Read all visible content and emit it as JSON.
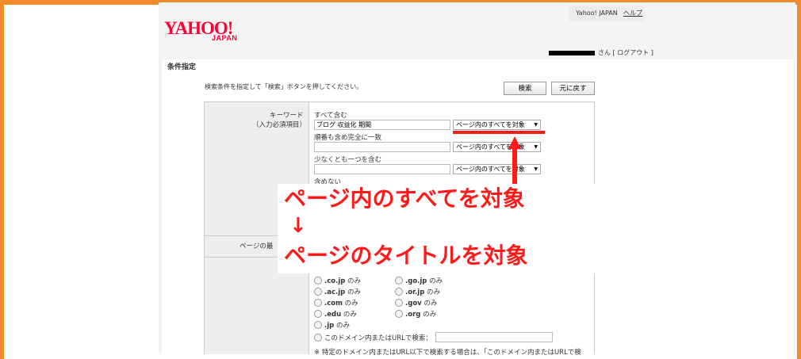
{
  "header": {
    "logo": "YAHOO!",
    "logo_sub": "JAPAN",
    "top_links": {
      "yahoo_japan": "Yahoo! JAPAN",
      "help": "ヘルプ"
    },
    "user_suffix": "さん",
    "logout": "[ ログアウト ]"
  },
  "form": {
    "section_title": "条件指定",
    "instruction": "検索条件を指定して「検索」ボタンを押してください。",
    "search_button": "検索",
    "back_button": "元に戻す",
    "keyword_label": "キーワード",
    "keyword_required": "（入力必須項目）",
    "all_words_label": "すべて含む",
    "all_words_value": "ブログ 収益化 期間",
    "all_words_scope": "ページ内のすべてを対象",
    "exact_label": "順番も含め完全に一致",
    "exact_scope": "ページ内のすべてを対象",
    "any_label": "少なくとも一つを含む",
    "any_scope": "ページ内のすべてを対象",
    "exclude_label": "含めない",
    "page_update_label": "ページの最",
    "domains": [
      ".co.jp",
      ".go.jp",
      ".ac.jp",
      ".or.jp",
      ".com",
      ".gov",
      ".edu",
      ".org",
      ".jp"
    ],
    "only_suffix": "のみ",
    "domain_search_label": "このドメイン内またはURLで検索：",
    "note": "※ 特定のドメイン内またはURL以下で検索する場合は、「このドメイン内またはURLで検"
  },
  "annotation": {
    "line1": "ページ内のすべてを対象",
    "arrow_down": "↓",
    "line2": "ページのタイトルを対象",
    "color": "#ff1a1a"
  }
}
